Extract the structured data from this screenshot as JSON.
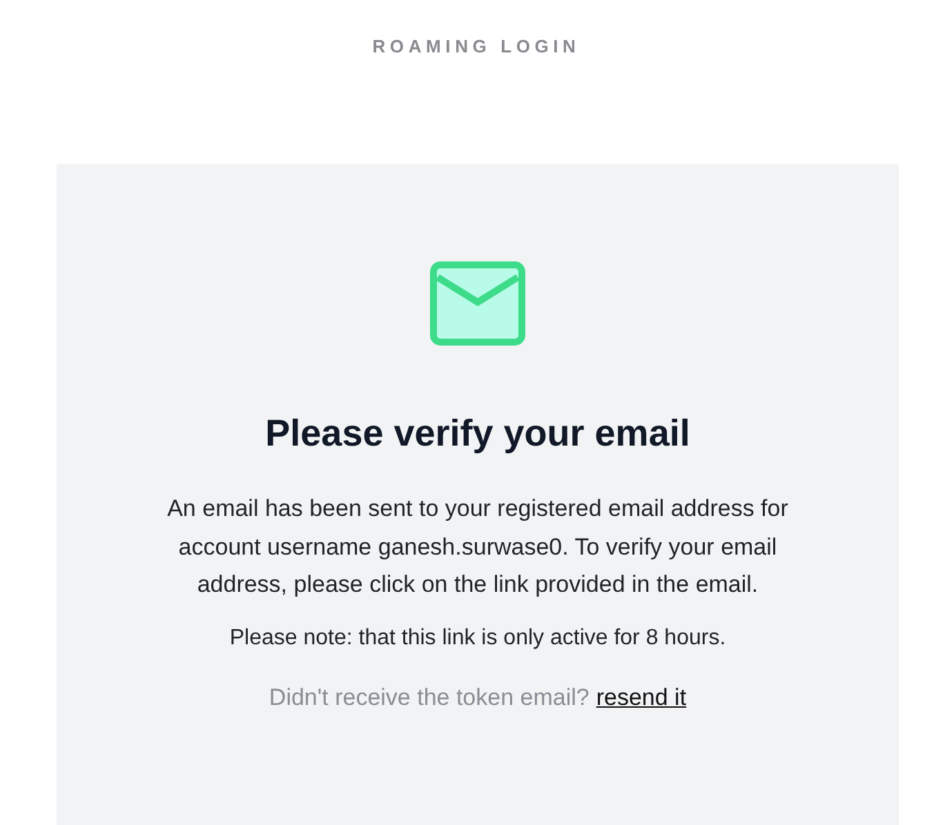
{
  "header": {
    "title": "ROAMING LOGIN"
  },
  "card": {
    "heading": "Please verify your email",
    "message": "An email has been sent to your registered email address for account username ganesh.surwase0. To verify your email address, please click on the link provided in the email.",
    "note": "Please note: that this link is only active for 8 hours.",
    "resend_prompt": "Didn't receive the token email?",
    "resend_link": "resend it"
  }
}
